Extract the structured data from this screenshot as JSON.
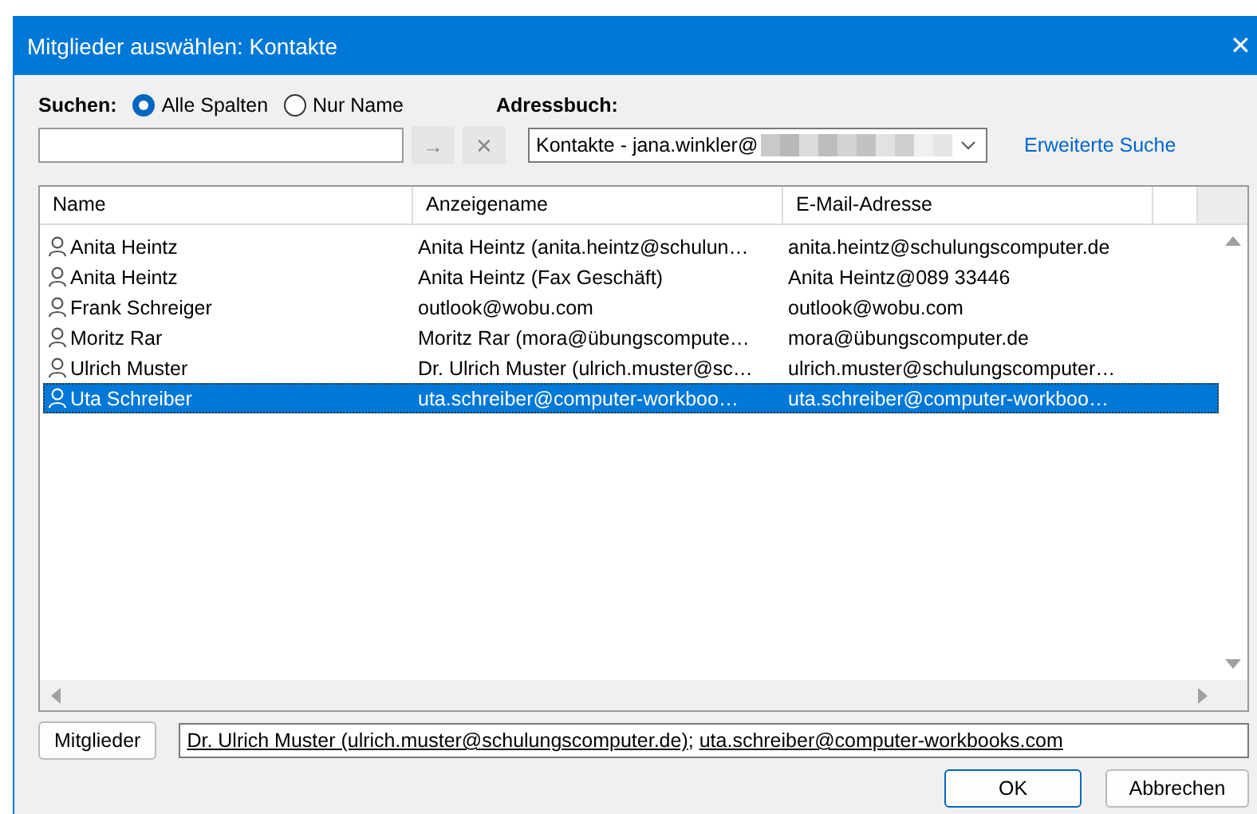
{
  "window": {
    "title": "Mitglieder auswählen: Kontakte",
    "close": "✕"
  },
  "search": {
    "label": "Suchen:",
    "options": [
      {
        "label": "Alle Spalten",
        "selected": true
      },
      {
        "label": "Nur Name",
        "selected": false
      }
    ],
    "go_button": "→",
    "clear_button": "✕"
  },
  "address_book": {
    "label": "Adressbuch:",
    "value": "Kontakte - jana.winkler@"
  },
  "advanced_search": "Erweiterte Suche",
  "table": {
    "columns": [
      "Name",
      "Anzeigename",
      "E-Mail-Adresse"
    ],
    "rows": [
      {
        "cells": [
          "Anita Heintz",
          "Anita Heintz (anita.heintz@schulun…",
          "anita.heintz@schulungscomputer.de"
        ],
        "selected": false
      },
      {
        "cells": [
          "Anita Heintz",
          "Anita Heintz (Fax Geschäft)",
          "Anita Heintz@089 33446"
        ],
        "selected": false
      },
      {
        "cells": [
          "Frank Schreiger",
          "outlook@wobu.com",
          "outlook@wobu.com"
        ],
        "selected": false
      },
      {
        "cells": [
          "Moritz Rar",
          "Moritz Rar (mora@übungscompute…",
          "mora@übungscomputer.de"
        ],
        "selected": false
      },
      {
        "cells": [
          "Ulrich Muster",
          "Dr. Ulrich Muster (ulrich.muster@sc…",
          "ulrich.muster@schulungscomputer…"
        ],
        "selected": false
      },
      {
        "cells": [
          "Uta Schreiber",
          "uta.schreiber@computer-workboo…",
          "uta.schreiber@computer-workboo…"
        ],
        "selected": true
      }
    ]
  },
  "members": {
    "button": "Mitglieder",
    "entries": [
      "Dr. Ulrich Muster (ulrich.muster@schulungscomputer.de)",
      "uta.schreiber@computer-workbooks.com"
    ],
    "separator": ";"
  },
  "buttons": [
    {
      "label": "OK",
      "default": true
    },
    {
      "label": "Abbrechen",
      "default": false
    }
  ]
}
